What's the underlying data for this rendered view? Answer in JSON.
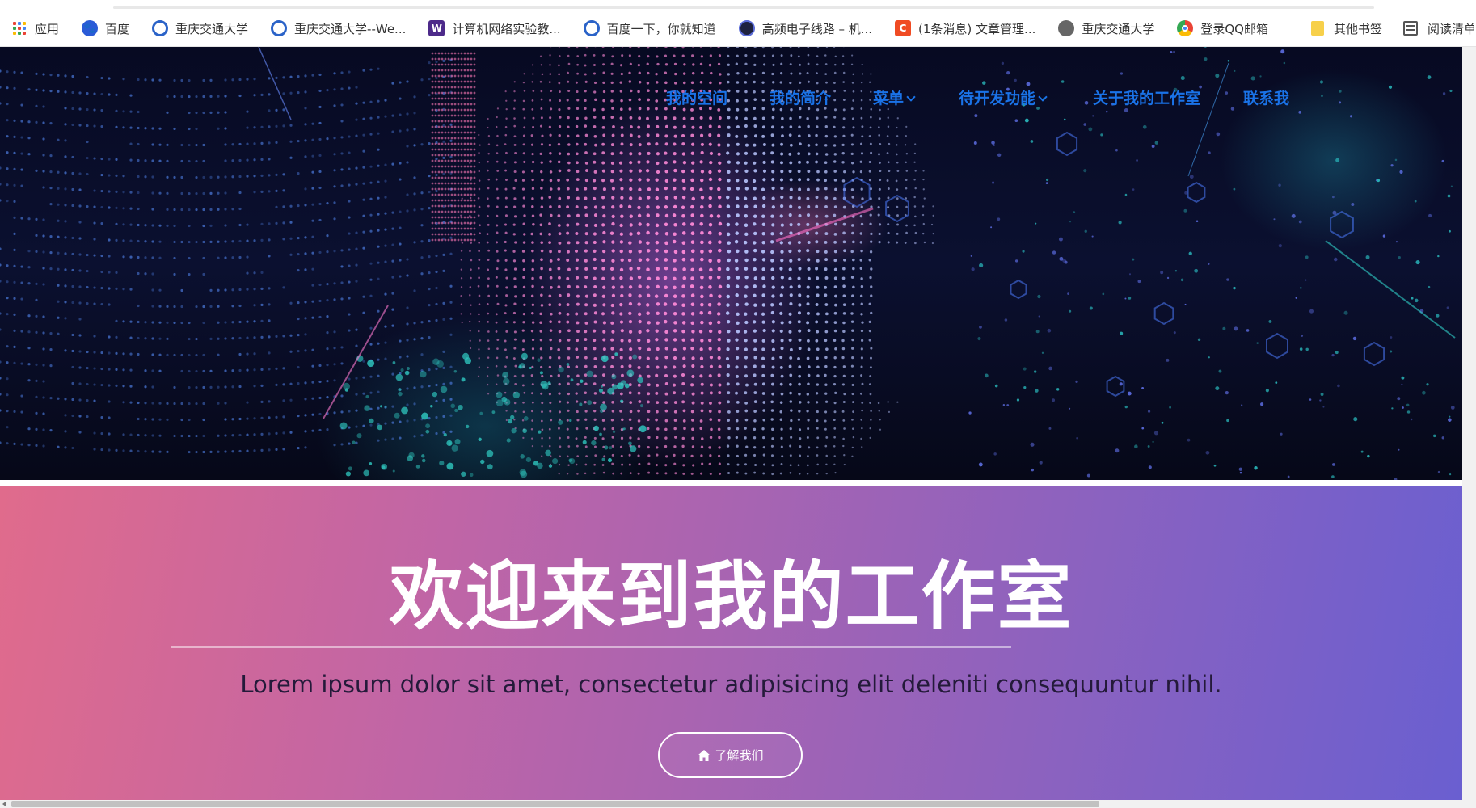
{
  "bookmarks": {
    "items": [
      {
        "label": "应用",
        "icon": "apps-grid-icon"
      },
      {
        "label": "百度",
        "icon": "baidu-paw-icon"
      },
      {
        "label": "重庆交通大学",
        "icon": "cqjtu-logo-icon"
      },
      {
        "label": "重庆交通大学--We...",
        "icon": "cqjtu-logo-icon"
      },
      {
        "label": "计算机网络实验教...",
        "icon": "w-letter-icon"
      },
      {
        "label": "百度一下，你就知道",
        "icon": "cqjtu-logo-icon"
      },
      {
        "label": "高频电子线路 – 机...",
        "icon": "dark-circle-icon"
      },
      {
        "label": "(1条消息) 文章管理...",
        "icon": "csdn-c-icon"
      },
      {
        "label": "重庆交通大学",
        "icon": "globe-icon"
      },
      {
        "label": "登录QQ邮箱",
        "icon": "qq-mail-icon"
      }
    ],
    "other_bookmarks": "其他书签",
    "reading_list": "阅读清单"
  },
  "nav": {
    "items": [
      {
        "label": "我的空间",
        "has_dropdown": false
      },
      {
        "label": "我的简介",
        "has_dropdown": false
      },
      {
        "label": "菜单",
        "has_dropdown": true
      },
      {
        "label": "待开发功能",
        "has_dropdown": true
      },
      {
        "label": "关于我的工作室",
        "has_dropdown": false
      },
      {
        "label": "联系我",
        "has_dropdown": false
      }
    ],
    "color": "#1a73e8"
  },
  "welcome": {
    "title": "欢迎来到我的工作室",
    "subtitle": "Lorem ipsum dolor sit amet, consectetur adipisicing elit deleniti consequuntur nihil.",
    "cta_label": "了解我们",
    "cta_icon": "home-icon",
    "gradient_start": "#e06b8c",
    "gradient_end": "#6a5fd0"
  }
}
